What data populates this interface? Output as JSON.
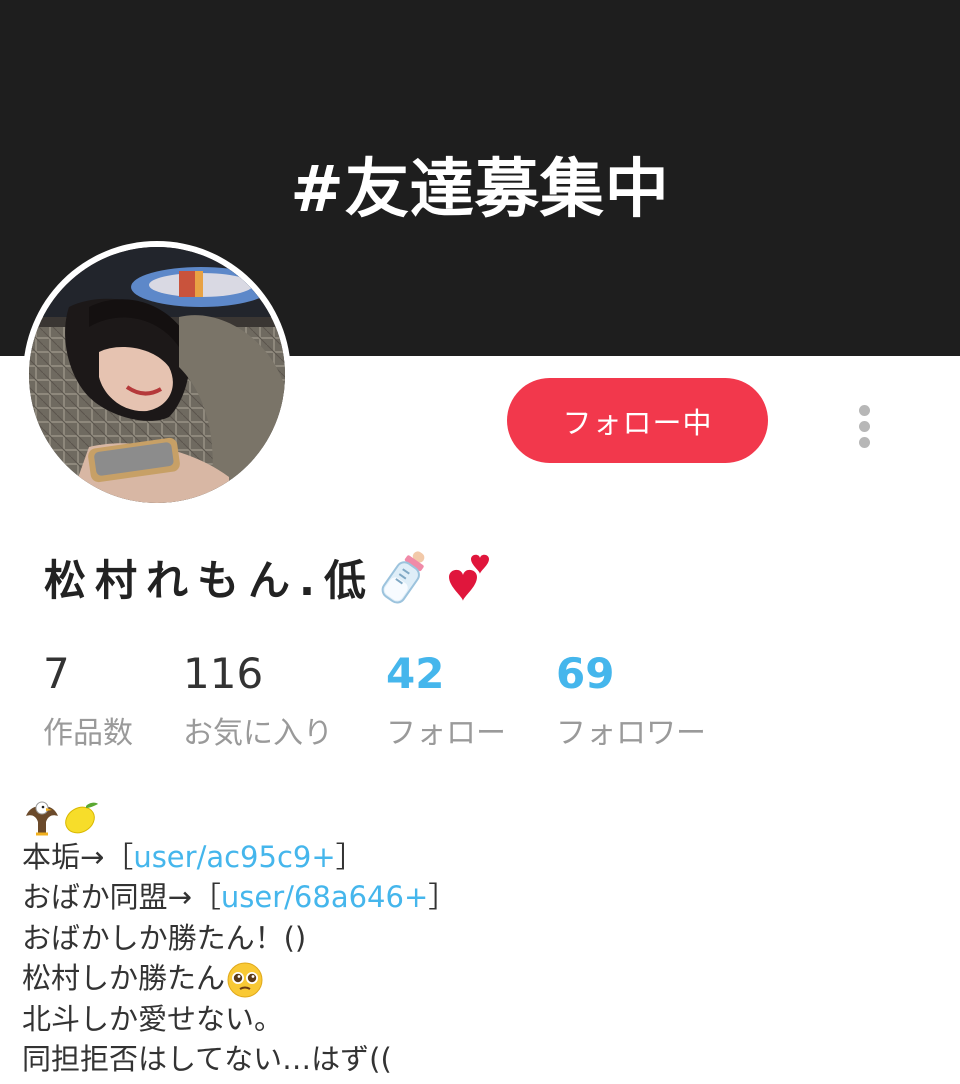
{
  "header": {
    "banner_text": "#友達募集中"
  },
  "profile": {
    "name": "松村れもん.低",
    "name_emoji": [
      "baby-bottle",
      "two-hearts"
    ],
    "follow_button_label": "フォロー中",
    "more_menu_icon": "vertical-ellipsis-icon"
  },
  "stats": [
    {
      "value": "7",
      "label": "作品数"
    },
    {
      "value": "116",
      "label": "お気に入り"
    },
    {
      "value": "42",
      "label": "フォロー"
    },
    {
      "value": "69",
      "label": "フォロワー"
    }
  ],
  "bio": {
    "line0_emoji": [
      "eagle",
      "lemon"
    ],
    "line1_prefix": "本垢→［",
    "line1_link": "user/ac95c9+",
    "line1_suffix": "］",
    "line2_prefix": "おばか同盟→［",
    "line2_link": "user/68a646+",
    "line2_suffix": "］",
    "line3": "おばかしか勝たん！()",
    "line4": "松村しか勝たん",
    "line4_emoji": "pleading-face",
    "line5": "北斗しか愛せない。",
    "line6": "同担拒否はしてない…はず(("
  },
  "colors": {
    "banner_bg": "#1e1e1e",
    "accent_red": "#f2384c",
    "link_blue": "#45b6ec",
    "label_gray": "#9a9a9a"
  }
}
